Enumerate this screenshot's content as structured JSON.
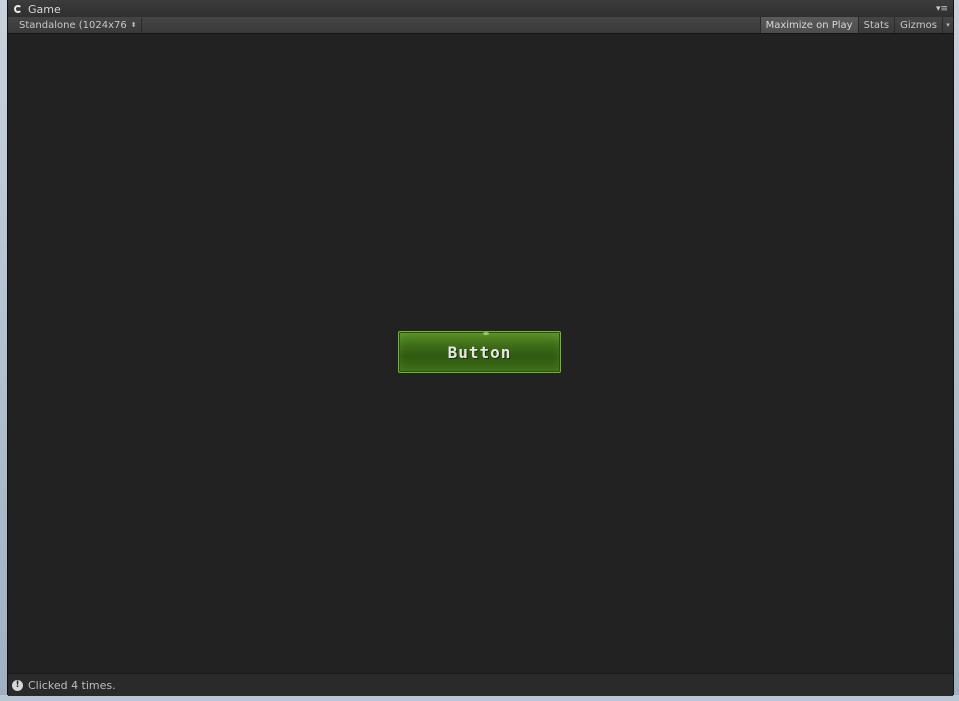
{
  "window": {
    "tab_title": "Game",
    "tab_icon": "pacman-icon",
    "tab_menu_icon": "tab-menu-icon"
  },
  "toolbar": {
    "aspect_label": "Standalone (1024x76",
    "aspect_arrows": "⬍",
    "maximize_label": "Maximize on Play",
    "maximize_active": true,
    "stats_label": "Stats",
    "gizmos_label": "Gizmos",
    "gizmos_arrow": "▾"
  },
  "game": {
    "button_label": "Button",
    "button_color": "#3d6c18",
    "button_border": "#6fb82a",
    "background": "#222222"
  },
  "status": {
    "icon": "info-icon",
    "message": "Clicked 4 times."
  }
}
